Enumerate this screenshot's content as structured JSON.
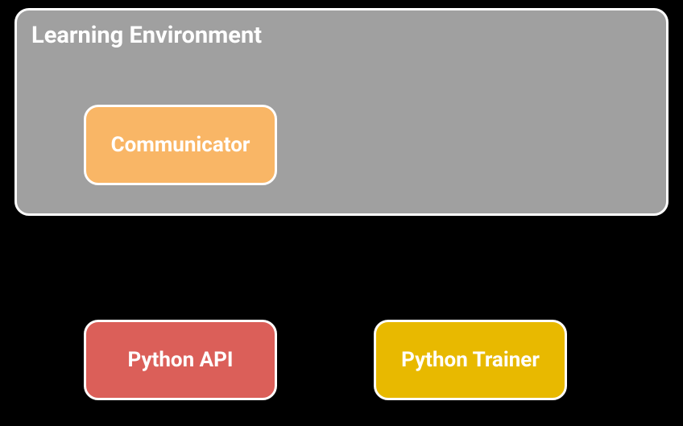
{
  "boxes": {
    "learning_environment": {
      "label": "Learning Environment",
      "color": "#a0a0a0"
    },
    "communicator": {
      "label": "Communicator",
      "color": "#f9b666"
    },
    "python_api": {
      "label": "Python API",
      "color": "#db5f59"
    },
    "python_trainer": {
      "label": "Python Trainer",
      "color": "#e8b900"
    }
  },
  "connectors": [
    {
      "from": "communicator",
      "to": "python_api",
      "style": "ball-socket-vertical"
    }
  ],
  "chart_data": {
    "type": "diagram",
    "title": "",
    "nodes": [
      {
        "id": "learning_environment",
        "label": "Learning Environment",
        "parent": null
      },
      {
        "id": "communicator",
        "label": "Communicator",
        "parent": "learning_environment"
      },
      {
        "id": "python_api",
        "label": "Python API",
        "parent": null
      },
      {
        "id": "python_trainer",
        "label": "Python Trainer",
        "parent": null
      }
    ],
    "edges": [
      {
        "from": "communicator",
        "to": "python_api"
      }
    ]
  }
}
